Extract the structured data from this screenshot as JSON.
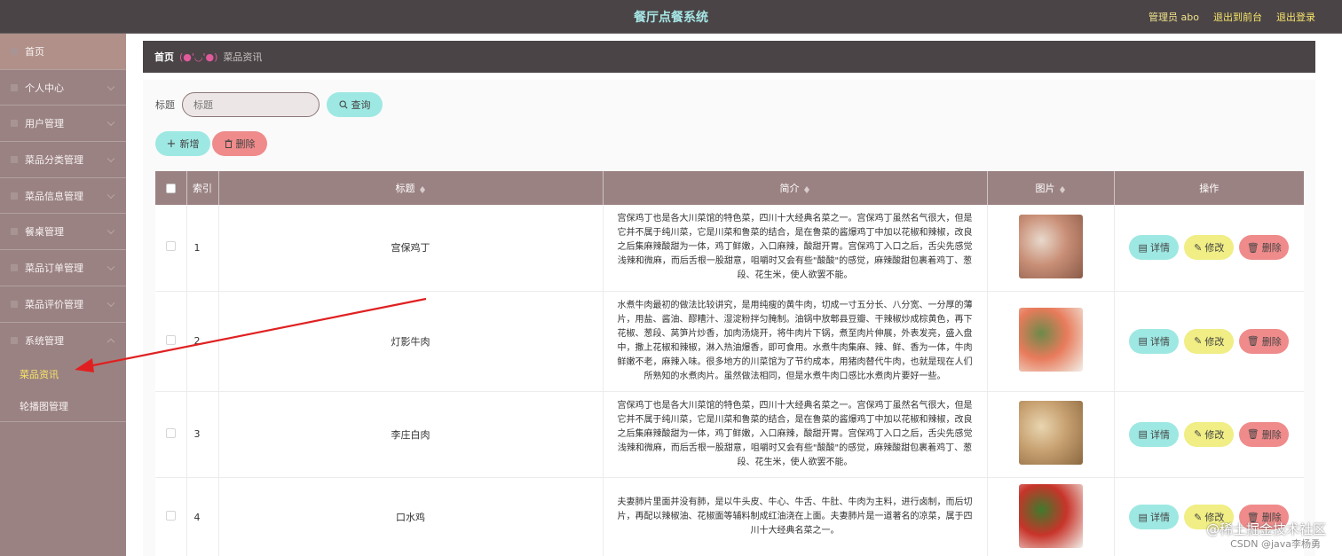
{
  "topbar": {
    "title": "餐厅点餐系统",
    "admin_label": "管理员 abo",
    "front_label": "退出到前台",
    "logout_label": "退出登录"
  },
  "sidebar": {
    "items": [
      {
        "label": "首页"
      },
      {
        "label": "个人中心"
      },
      {
        "label": "用户管理"
      },
      {
        "label": "菜品分类管理"
      },
      {
        "label": "菜品信息管理"
      },
      {
        "label": "餐桌管理"
      },
      {
        "label": "菜品订单管理"
      },
      {
        "label": "菜品评价管理"
      },
      {
        "label": "系统管理"
      }
    ],
    "subitems": [
      {
        "label": "菜品资讯"
      },
      {
        "label": "轮播图管理"
      }
    ]
  },
  "breadcrumb": {
    "home": "首页",
    "separator": "(●'◡'●)",
    "current": "菜品资讯"
  },
  "search": {
    "label": "标题",
    "placeholder": "标题",
    "button": "查询"
  },
  "actions": {
    "add": "新增",
    "delete": "删除"
  },
  "table": {
    "headers": {
      "index": "索引",
      "title": "标题",
      "summary": "简介",
      "image": "图片",
      "ops": "操作"
    },
    "rows": [
      {
        "index": "1",
        "title": "宫保鸡丁",
        "summary": "宫保鸡丁也是各大川菜馆的特色菜，四川十大经典名菜之一。宫保鸡丁虽然名气很大，但是它并不属于纯川菜，它是川菜和鲁菜的结合，是在鲁菜的酱爆鸡丁中加以花椒和辣椒，改良之后集麻辣酸甜为一体，鸡丁鲜嫩，入口麻辣，酸甜开胃。宫保鸡丁入口之后，舌尖先感觉浅辣和微麻，而后舌根一股甜意，咀嚼时又会有些\"酸酸\"的感觉，麻辣酸甜包裹着鸡丁、葱段、花生米，使人欲罢不能。",
        "image_colors": [
          "#e8d9cc",
          "#c98f77",
          "#8a5a48"
        ]
      },
      {
        "index": "2",
        "title": "灯影牛肉",
        "summary": "水煮牛肉最初的做法比较讲究，是用纯瘦的黄牛肉，切成一寸五分长、八分宽、一分厚的薄片，用盐、酱油、醪糟汁、湿淀粉拌匀腌制。油锅中放郫县豆瓣、干辣椒炒成棕黄色，再下花椒、葱段、莴笋片炒香，加肉汤烧开，将牛肉片下锅，煮至肉片伸展，外表发亮，盛入盘中，撒上花椒和辣椒，淋入热油爆香，即可食用。水煮牛肉集麻、辣、鲜、香为一体，牛肉鲜嫩不老，麻辣入味。很多地方的川菜馆为了节约成本，用猪肉替代牛肉，也就是现在人们所熟知的水煮肉片。虽然做法相同，但是水煮牛肉口感比水煮肉片要好一些。",
        "image_colors": [
          "#6c8a4a",
          "#e87b5b",
          "#f2f0e8"
        ]
      },
      {
        "index": "3",
        "title": "李庄白肉",
        "summary": "宫保鸡丁也是各大川菜馆的特色菜，四川十大经典名菜之一。宫保鸡丁虽然名气很大，但是它并不属于纯川菜，它是川菜和鲁菜的结合，是在鲁菜的酱爆鸡丁中加以花椒和辣椒，改良之后集麻辣酸甜为一体，鸡丁鲜嫩，入口麻辣，酸甜开胃。宫保鸡丁入口之后，舌尖先感觉浅辣和微麻，而后舌根一股甜意，咀嚼时又会有些\"酸酸\"的感觉，麻辣酸甜包裹着鸡丁、葱段、花生米，使人欲罢不能。",
        "image_colors": [
          "#e8d5b0",
          "#c7a070",
          "#8a6840"
        ]
      },
      {
        "index": "4",
        "title": "口水鸡",
        "summary": "夫妻肺片里面并没有肺，是以牛头皮、牛心、牛舌、牛肚、牛肉为主料，进行卤制，而后切片，再配以辣椒油、花椒面等辅料制成红油浇在上面。夫妻肺片是一道著名的凉菜，属于四川十大经典名菜之一。",
        "image_colors": [
          "#3f7a2c",
          "#c8342a",
          "#f0f0ea"
        ]
      }
    ],
    "ops": {
      "detail": "详情",
      "edit": "修改",
      "delete": "删除"
    }
  },
  "watermark": {
    "line1": "@稀土掘金技术社区",
    "line2": "CSDN @java李杨勇"
  }
}
